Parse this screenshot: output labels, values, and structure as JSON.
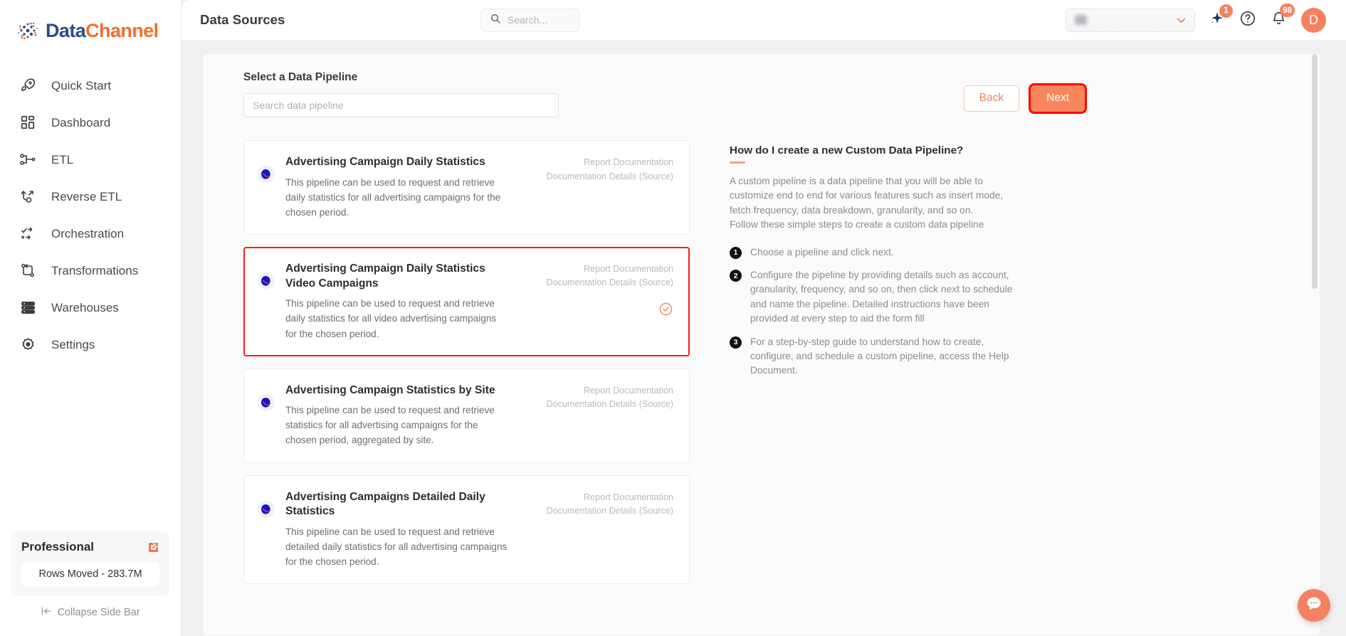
{
  "brand": {
    "name_part1": "Data",
    "name_part2": "Channel",
    "accent_color": "#f26f2c",
    "navy_color": "#2d4a86"
  },
  "sidebar": {
    "items": [
      {
        "label": "Quick Start",
        "icon": "rocket-icon"
      },
      {
        "label": "Dashboard",
        "icon": "grid-icon"
      },
      {
        "label": "ETL",
        "icon": "etl-icon"
      },
      {
        "label": "Reverse ETL",
        "icon": "reverse-etl-icon"
      },
      {
        "label": "Orchestration",
        "icon": "orchestration-icon"
      },
      {
        "label": "Transformations",
        "icon": "transformations-icon"
      },
      {
        "label": "Warehouses",
        "icon": "warehouse-icon"
      },
      {
        "label": "Settings",
        "icon": "gear-icon"
      }
    ],
    "plan": {
      "name": "Professional",
      "rows_moved": "Rows Moved - 283.7M",
      "external_icon": "external-link-icon"
    },
    "collapse_label": "Collapse Side Bar"
  },
  "header": {
    "title": "Data Sources",
    "search_placeholder": "Search...",
    "search_value": "",
    "account_selector_value": "",
    "ai_badge_count": "1",
    "notification_badge_count": "98",
    "avatar_initial": "D",
    "help_icon": "question-circle-icon",
    "bell_icon": "bell-icon",
    "sparkle_icon": "sparkle-icon",
    "chevron_icon": "chevron-down-icon"
  },
  "main": {
    "section_label": "Select a Data Pipeline",
    "pipeline_search_placeholder": "Search data pipeline",
    "pipeline_search_value": "",
    "back_label": "Back",
    "next_label": "Next",
    "doc_link_1": "Report Documentation",
    "doc_link_2": "Documentation Details (Source)",
    "pipelines": [
      {
        "title": "Advertising Campaign Daily Statistics",
        "description": "This pipeline can be used to request and retrieve daily statistics for all advertising campaigns for the chosen period.",
        "selected": false,
        "icon": "yandex-direct-icon"
      },
      {
        "title": "Advertising Campaign Daily Statistics Video Campaigns",
        "description": "This pipeline can be used to request and retrieve daily statistics for all video advertising campaigns for the chosen period.",
        "selected": true,
        "icon": "yandex-direct-icon"
      },
      {
        "title": "Advertising Campaign Statistics by Site",
        "description": "This pipeline can be used to request and retrieve statistics for all advertising campaigns for the chosen period, aggregated by site.",
        "selected": false,
        "icon": "yandex-direct-icon"
      },
      {
        "title": "Advertising Campaigns Detailed Daily Statistics",
        "description": "This pipeline can be used to request and retrieve detailed daily statistics for all advertising campaigns for the chosen period.",
        "selected": false,
        "icon": "yandex-direct-icon"
      }
    ]
  },
  "help": {
    "title": "How do I create a new Custom Data Pipeline?",
    "paragraph": "A custom pipeline is a data pipeline that you will be able to customize end to end for various features such as insert mode, fetch frequency, data breakdown, granularity, and so on.\nFollow these simple steps to create a custom data pipeline",
    "steps": [
      {
        "num": "1",
        "text": "Choose a pipeline and click next."
      },
      {
        "num": "2",
        "text": "Configure the pipeline by providing details such as account, granularity, frequency, and so on, then click next to schedule and name the pipeline. Detailed instructions have been provided at every step to aid the form fill"
      },
      {
        "num": "3",
        "text": "For a step-by-step guide to understand how to create, configure, and schedule a custom pipeline, access the Help Document."
      }
    ]
  },
  "chat": {
    "icon": "chat-bubble-icon"
  }
}
